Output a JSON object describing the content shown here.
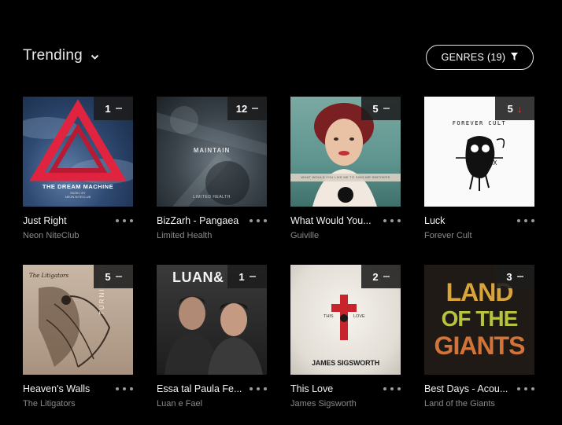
{
  "header": {
    "title": "Trending",
    "title_icon": "chevron-down-icon",
    "genres_button": "GENRES (19)",
    "genres_icon": "filter-icon"
  },
  "colors": {
    "background": "#000000",
    "text": "#ffffff",
    "subtext": "#8a8a8a",
    "trend_down": "#e53935"
  },
  "tracks": [
    {
      "song": "Just Right",
      "artist": "Neon NiteClub",
      "rank": "1",
      "trend": "same",
      "cover": {
        "line1": "THE DREAM MACHINE",
        "line2": "MUSIC BY",
        "line3": "NEON NITECLUB"
      }
    },
    {
      "song": "BizZarh - Pangaea",
      "artist": "Limited Health",
      "rank": "12",
      "trend": "same",
      "cover": {
        "line1": "MAINTAIN",
        "line2": "LIMITED HEALTH"
      }
    },
    {
      "song": "What Would You...",
      "artist": "Guiville",
      "rank": "5",
      "trend": "same",
      "cover": {
        "line1": "WHAT WOULD YOU LIKE ME TO SING MR SMITHERS"
      }
    },
    {
      "song": "Luck",
      "artist": "Forever Cult",
      "rank": "5",
      "trend": "down",
      "cover": {
        "line1": "FOREVER CULT",
        "line2": "FUXX"
      }
    },
    {
      "song": "Heaven's Walls",
      "artist": "The Litigators",
      "rank": "5",
      "trend": "same",
      "cover": {
        "line1": "The Litigators",
        "line2": "TURNING HE"
      }
    },
    {
      "song": "Essa tal Paula Fe...",
      "artist": "Luan e Fael",
      "rank": "1",
      "trend": "same",
      "cover": {
        "line1": "LUAN&"
      }
    },
    {
      "song": "This Love",
      "artist": "James Sigsworth",
      "rank": "2",
      "trend": "same",
      "cover": {
        "line1": "THIS",
        "line2": "LOVE",
        "line3": "JAMES SIGSWORTH"
      }
    },
    {
      "song": "Best Days - Acou...",
      "artist": "Land of the Giants",
      "rank": "3",
      "trend": "same",
      "cover": {
        "line1": "LAND",
        "line2": "OF THE",
        "line3": "GIANTS"
      }
    }
  ]
}
